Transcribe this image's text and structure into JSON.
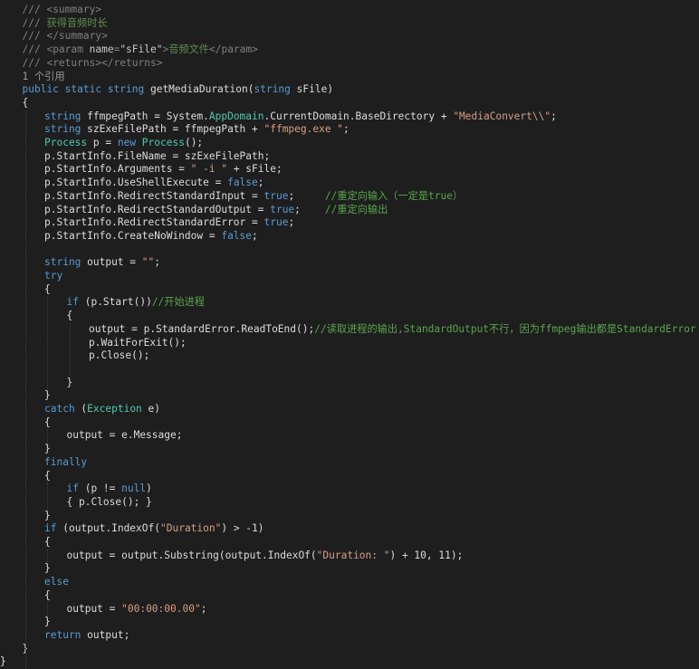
{
  "colors": {
    "background": "#1e1e1e",
    "plain": "#dcdcdc",
    "keyword": "#569cd6",
    "type": "#4ec9b0",
    "string": "#d69d85",
    "comment": "#57a64a",
    "doc_comment": "#608b4e",
    "doc_tag": "#808080",
    "codelens": "#999999"
  },
  "editor": {
    "lines": [
      {
        "indent": 1,
        "tokens": [
          [
            "/// ",
            "tag"
          ],
          [
            "<summary>",
            "tag"
          ]
        ]
      },
      {
        "indent": 1,
        "tokens": [
          [
            "/// ",
            "tag"
          ],
          [
            "获得音频时长",
            "doc"
          ]
        ]
      },
      {
        "indent": 1,
        "tokens": [
          [
            "/// ",
            "tag"
          ],
          [
            "</summary>",
            "tag"
          ]
        ]
      },
      {
        "indent": 1,
        "tokens": [
          [
            "/// ",
            "tag"
          ],
          [
            "<param ",
            "tag"
          ],
          [
            "name",
            "docattr"
          ],
          [
            "=",
            "tag"
          ],
          [
            "\"sFile\"",
            "docattr"
          ],
          [
            ">",
            "tag"
          ],
          [
            "音频文件",
            "doc"
          ],
          [
            "</param>",
            "tag"
          ]
        ]
      },
      {
        "indent": 1,
        "tokens": [
          [
            "/// ",
            "tag"
          ],
          [
            "<returns></returns>",
            "tag"
          ]
        ]
      },
      {
        "indent": 1,
        "tokens": [
          [
            "1 个引用",
            "lens"
          ]
        ]
      },
      {
        "indent": 1,
        "tokens": [
          [
            "public ",
            "kw"
          ],
          [
            "static ",
            "kw"
          ],
          [
            "string ",
            "kw"
          ],
          [
            "getMediaDuration(",
            "plain"
          ],
          [
            "string ",
            "kw"
          ],
          [
            "sFile)",
            "plain"
          ]
        ]
      },
      {
        "indent": 1,
        "tokens": [
          [
            "{",
            "plain"
          ]
        ]
      },
      {
        "indent": 2,
        "tokens": [
          [
            "string ",
            "kw"
          ],
          [
            "ffmpegPath = System.",
            "plain"
          ],
          [
            "AppDomain",
            "type"
          ],
          [
            ".CurrentDomain.BaseDirectory + ",
            "plain"
          ],
          [
            "\"MediaConvert\\\\\"",
            "str"
          ],
          [
            ";",
            "plain"
          ]
        ]
      },
      {
        "indent": 2,
        "tokens": [
          [
            "string ",
            "kw"
          ],
          [
            "szExeFilePath = ffmpegPath + ",
            "plain"
          ],
          [
            "\"ffmpeg.exe \"",
            "str"
          ],
          [
            ";",
            "plain"
          ]
        ]
      },
      {
        "indent": 2,
        "tokens": [
          [
            "Process ",
            "type"
          ],
          [
            "p = ",
            "plain"
          ],
          [
            "new ",
            "kw"
          ],
          [
            "Process",
            "type"
          ],
          [
            "();",
            "plain"
          ]
        ]
      },
      {
        "indent": 2,
        "tokens": [
          [
            "p.StartInfo.FileName = szExeFilePath;",
            "plain"
          ]
        ]
      },
      {
        "indent": 2,
        "tokens": [
          [
            "p.StartInfo.Arguments = ",
            "plain"
          ],
          [
            "\" -i \"",
            "str"
          ],
          [
            " + sFile;",
            "plain"
          ]
        ]
      },
      {
        "indent": 2,
        "tokens": [
          [
            "p.StartInfo.UseShellExecute = ",
            "plain"
          ],
          [
            "false",
            "kw"
          ],
          [
            ";",
            "plain"
          ]
        ]
      },
      {
        "indent": 2,
        "tokens": [
          [
            "p.StartInfo.RedirectStandardInput = ",
            "plain"
          ],
          [
            "true",
            "kw"
          ],
          [
            ";     ",
            "plain"
          ],
          [
            "//重定向输入（一定是true）",
            "com"
          ]
        ]
      },
      {
        "indent": 2,
        "tokens": [
          [
            "p.StartInfo.RedirectStandardOutput = ",
            "plain"
          ],
          [
            "true",
            "kw"
          ],
          [
            ";    ",
            "plain"
          ],
          [
            "//重定向输出",
            "com"
          ]
        ]
      },
      {
        "indent": 2,
        "tokens": [
          [
            "p.StartInfo.RedirectStandardError = ",
            "plain"
          ],
          [
            "true",
            "kw"
          ],
          [
            ";",
            "plain"
          ]
        ]
      },
      {
        "indent": 2,
        "tokens": [
          [
            "p.StartInfo.CreateNoWindow = ",
            "plain"
          ],
          [
            "false",
            "kw"
          ],
          [
            ";",
            "plain"
          ]
        ]
      },
      {
        "indent": 2,
        "tokens": []
      },
      {
        "indent": 2,
        "tokens": [
          [
            "string ",
            "kw"
          ],
          [
            "output = ",
            "plain"
          ],
          [
            "\"\"",
            "str"
          ],
          [
            ";",
            "plain"
          ]
        ]
      },
      {
        "indent": 2,
        "tokens": [
          [
            "try",
            "kw"
          ]
        ]
      },
      {
        "indent": 2,
        "tokens": [
          [
            "{",
            "plain"
          ]
        ]
      },
      {
        "indent": 3,
        "tokens": [
          [
            "if ",
            "kw"
          ],
          [
            "(p.Start())",
            "plain"
          ],
          [
            "//开始进程",
            "com"
          ]
        ]
      },
      {
        "indent": 3,
        "tokens": [
          [
            "{",
            "plain"
          ]
        ]
      },
      {
        "indent": 4,
        "tokens": [
          [
            "output = p.StandardError.ReadToEnd();",
            "plain"
          ],
          [
            "//读取进程的输出,StandardOutput不行，因为ffmpeg输出都是StandardError",
            "com"
          ]
        ]
      },
      {
        "indent": 4,
        "tokens": [
          [
            "p.WaitForExit();",
            "plain"
          ]
        ]
      },
      {
        "indent": 4,
        "tokens": [
          [
            "p.Close();",
            "plain"
          ]
        ]
      },
      {
        "indent": 4,
        "tokens": []
      },
      {
        "indent": 3,
        "tokens": [
          [
            "}",
            "plain"
          ]
        ]
      },
      {
        "indent": 2,
        "tokens": [
          [
            "}",
            "plain"
          ]
        ]
      },
      {
        "indent": 2,
        "tokens": [
          [
            "catch ",
            "kw"
          ],
          [
            "(",
            "plain"
          ],
          [
            "Exception ",
            "type"
          ],
          [
            "e)",
            "plain"
          ]
        ]
      },
      {
        "indent": 2,
        "tokens": [
          [
            "{",
            "plain"
          ]
        ]
      },
      {
        "indent": 3,
        "tokens": [
          [
            "output = e.Message;",
            "plain"
          ]
        ]
      },
      {
        "indent": 2,
        "tokens": [
          [
            "}",
            "plain"
          ]
        ]
      },
      {
        "indent": 2,
        "tokens": [
          [
            "finally",
            "kw"
          ]
        ]
      },
      {
        "indent": 2,
        "tokens": [
          [
            "{",
            "plain"
          ]
        ]
      },
      {
        "indent": 3,
        "tokens": [
          [
            "if ",
            "kw"
          ],
          [
            "(p != ",
            "plain"
          ],
          [
            "null",
            "kw"
          ],
          [
            ")",
            "plain"
          ]
        ]
      },
      {
        "indent": 3,
        "tokens": [
          [
            "{ p.Close(); }",
            "plain"
          ]
        ]
      },
      {
        "indent": 2,
        "tokens": [
          [
            "}",
            "plain"
          ]
        ]
      },
      {
        "indent": 2,
        "tokens": [
          [
            "if ",
            "kw"
          ],
          [
            "(output.IndexOf(",
            "plain"
          ],
          [
            "\"Duration\"",
            "str"
          ],
          [
            ") > -1)",
            "plain"
          ]
        ]
      },
      {
        "indent": 2,
        "tokens": [
          [
            "{",
            "plain"
          ]
        ]
      },
      {
        "indent": 3,
        "tokens": [
          [
            "output = output.Substring(output.IndexOf(",
            "plain"
          ],
          [
            "\"Duration: \"",
            "str"
          ],
          [
            ") + 10, 11);",
            "plain"
          ]
        ]
      },
      {
        "indent": 2,
        "tokens": [
          [
            "}",
            "plain"
          ]
        ]
      },
      {
        "indent": 2,
        "tokens": [
          [
            "else",
            "kw"
          ]
        ]
      },
      {
        "indent": 2,
        "tokens": [
          [
            "{",
            "plain"
          ]
        ]
      },
      {
        "indent": 3,
        "tokens": [
          [
            "output = ",
            "plain"
          ],
          [
            "\"00:00:00.00\"",
            "str"
          ],
          [
            ";",
            "plain"
          ]
        ]
      },
      {
        "indent": 2,
        "tokens": [
          [
            "}",
            "plain"
          ]
        ]
      },
      {
        "indent": 2,
        "tokens": [
          [
            "return ",
            "kw"
          ],
          [
            "output;",
            "plain"
          ]
        ]
      },
      {
        "indent": 1,
        "tokens": [
          [
            "}",
            "plain"
          ]
        ]
      },
      {
        "indent": 0,
        "tokens": [
          [
            "}",
            "plain"
          ]
        ]
      }
    ]
  }
}
